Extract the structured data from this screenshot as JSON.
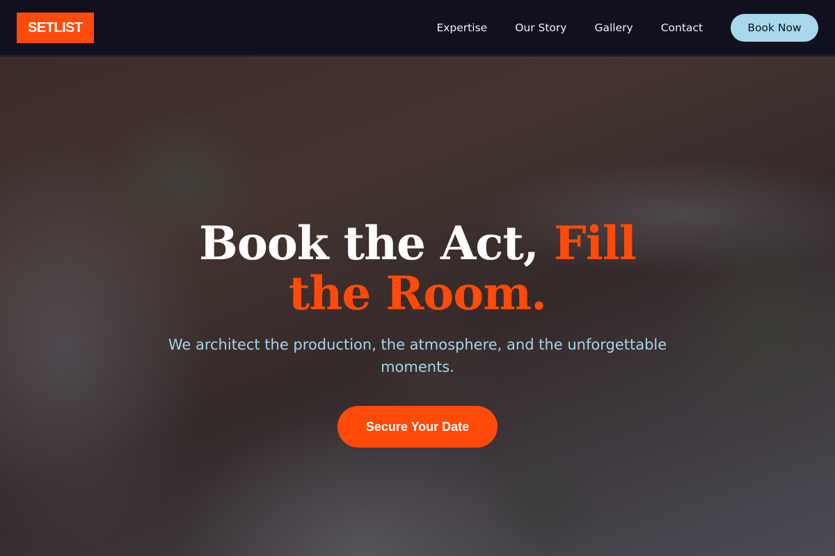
{
  "header": {
    "logo": "SETLIST",
    "nav": [
      {
        "label": "Expertise"
      },
      {
        "label": "Our Story"
      },
      {
        "label": "Gallery"
      },
      {
        "label": "Contact"
      }
    ],
    "book_label": "Book Now"
  },
  "hero": {
    "headline_plain": "Book the Act, ",
    "headline_accent": "Fill the Room.",
    "subtitle": "We architect the production, the atmosphere, and the unforgettable moments.",
    "cta_label": "Secure Your Date"
  },
  "colors": {
    "accent": "#ff4a0a",
    "nav_bg": "#10101f",
    "book_button": "#a8d8eb",
    "subtitle": "#a8d4e8"
  }
}
